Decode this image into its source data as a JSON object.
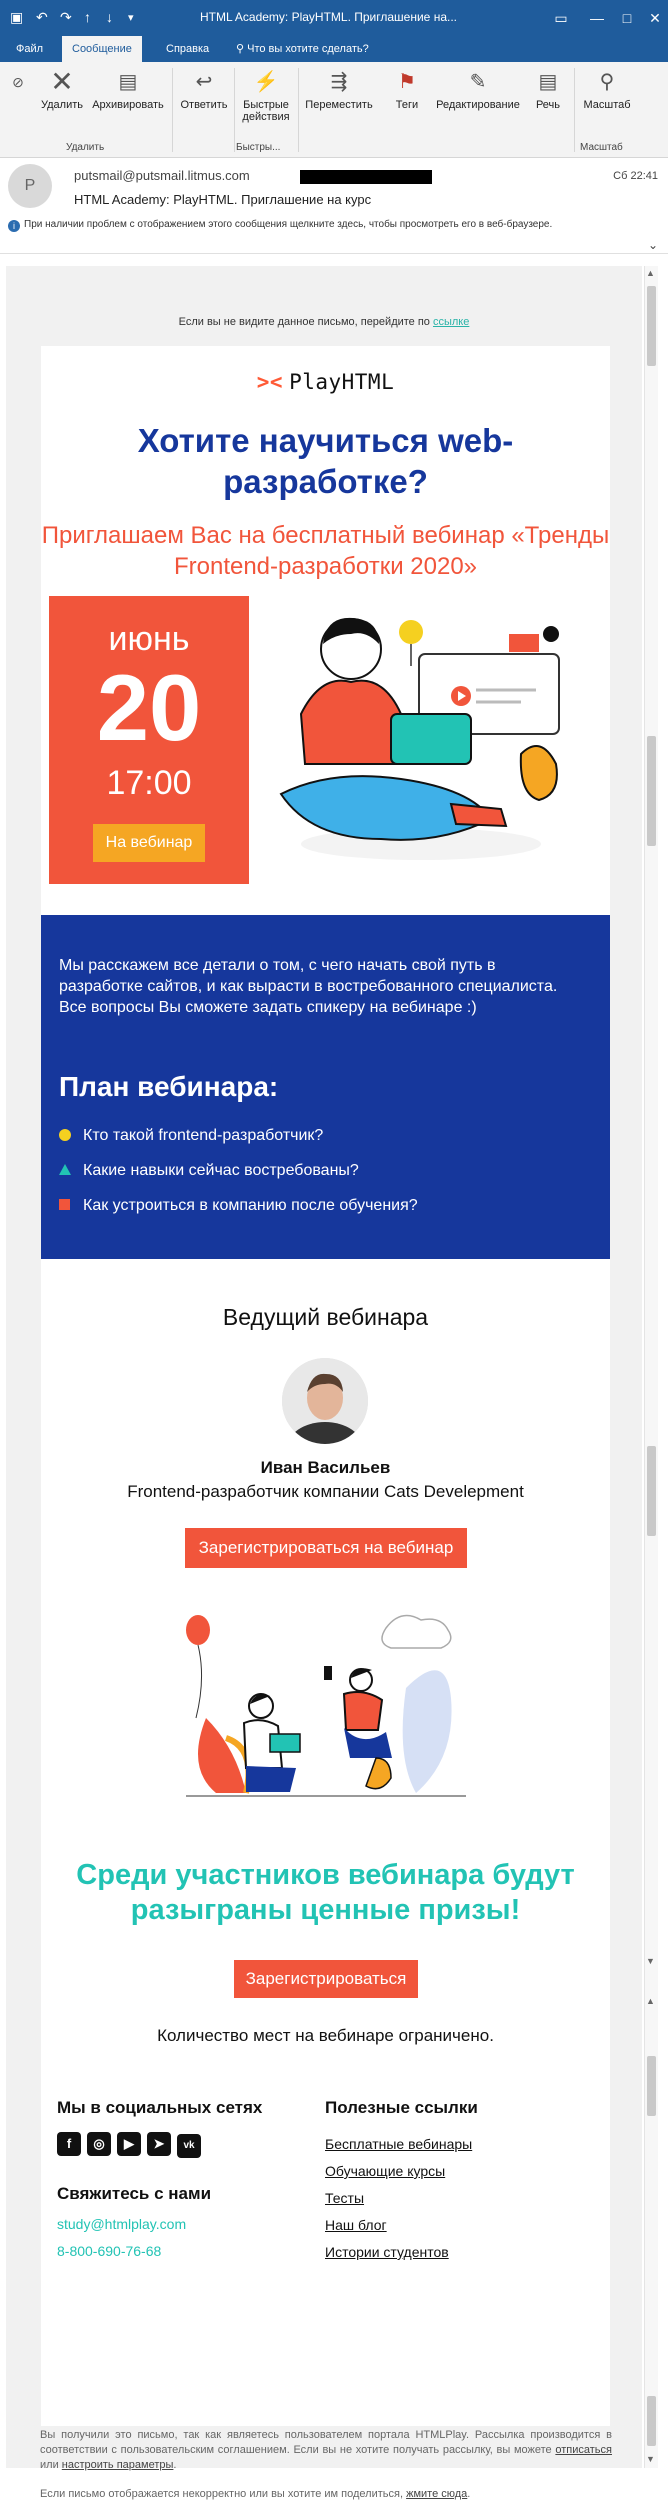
{
  "window": {
    "title": "HTML Academy: PlayHTML. Приглашение на...",
    "tabs": [
      "Файл",
      "Сообщение",
      "Справка"
    ],
    "tell_me": "Что вы хотите сделать?"
  },
  "ribbon": {
    "buttons": [
      "Удалить",
      "Архивировать",
      "Ответить",
      "Быстрые действия",
      "Переместить",
      "Теги",
      "Редактирование",
      "Речь",
      "Масштаб"
    ],
    "groups": [
      "Удалить",
      "Быстры...",
      "Масштаб"
    ]
  },
  "message": {
    "avatar_letter": "P",
    "from": "putsmail@putsmail.litmus.com",
    "time": "Сб 22:41",
    "subject": "HTML Academy: PlayHTML. Приглашение на курс",
    "info": "При наличии проблем с отображением этого сообщения щелкните здесь, чтобы просмотреть его в веб-браузере."
  },
  "email": {
    "preheader_text": "Если вы не видите данное письмо, перейдите по",
    "preheader_link": "ссылке",
    "logo": "PlayHTML",
    "headline": "Хотите научиться web-разработке?",
    "subheadline": "Приглашаем Вас на бесплатный вебинар «Тренды Frontend-разработки 2020»",
    "date": {
      "month": "июнь",
      "day": "20",
      "time": "17:00",
      "cta": "На вебинар"
    },
    "intro": "Мы расскажем все детали о том, с чего начать свой путь в разработке сайтов, и как вырасти в востребованного специалиста. Все вопросы Вы сможете задать спикеру на вебинаре :)",
    "plan_title": "План вебинара:",
    "plan_items": [
      "Кто такой frontend-разработчик?",
      "Какие навыки сейчас востребованы?",
      "Как устроиться в компанию после обучения?"
    ],
    "speaker_title": "Ведущий вебинара",
    "speaker_name": "Иван Васильев",
    "speaker_role": "Frontend-разработчик компании Cats Develepment",
    "register_webinar": "Зарегистрироваться на вебинар",
    "prize_text": "Среди участников вебинара будут разыграны ценные призы!",
    "register": "Зарегистрироваться",
    "limit": "Количество мест на вебинаре ограничено.",
    "social_title": "Мы в социальных сетях",
    "social_icons": [
      "facebook-icon",
      "instagram-icon",
      "youtube-icon",
      "telegram-icon",
      "vk-icon"
    ],
    "contact_title": "Свяжитесь с нами",
    "email_address": "study@htmlplay.com",
    "phone": "8-800-690-76-68",
    "links_title": "Полезные ссылки",
    "links": [
      "Бесплатные вебинары",
      "Обучающие курсы",
      "Тесты",
      "Наш блог",
      "Истории студентов"
    ],
    "footer_text_1": "Вы получили это письмо, так как являетесь пользователем портала HTMLPlay. Рассылка производится в соответствии с пользовательским соглашением. Если вы не хотите получать рассылку, вы можете",
    "footer_unsub": "отписаться",
    "footer_or": "или",
    "footer_settings": "настроить параметры",
    "footer_text_2": "Если письмо отображается некорректно или вы хотите им поделиться,",
    "footer_share": "жмите сюда"
  },
  "colors": {
    "window_blue": "#1f5c9c",
    "brand_blue": "#16379c",
    "accent_red": "#f1553b",
    "accent_orange": "#f5a623",
    "accent_teal": "#22c3b4",
    "accent_yellow": "#f5d020"
  }
}
